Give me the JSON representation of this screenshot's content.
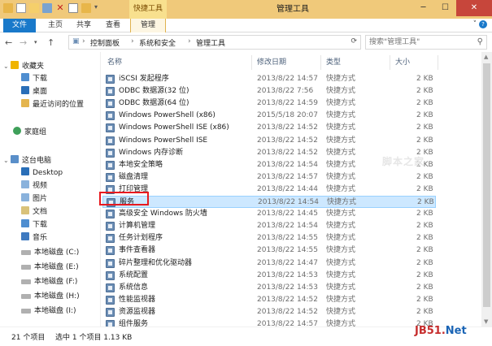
{
  "window": {
    "title": "管理工具",
    "tool_tab": "快捷工具"
  },
  "ribbon": {
    "tabs": [
      "文件",
      "主页",
      "共享",
      "查看",
      "管理"
    ]
  },
  "address": {
    "crumbs": [
      "控制面板",
      "系统和安全",
      "管理工具"
    ],
    "search_placeholder": "搜索\"管理工具\""
  },
  "nav": {
    "favorites": "收藏夹",
    "fav_items": [
      "下载",
      "桌面",
      "最近访问的位置"
    ],
    "homegroup": "家庭组",
    "thispc": "这台电脑",
    "pc_items": [
      "Desktop",
      "视频",
      "图片",
      "文档",
      "下载",
      "音乐",
      "本地磁盘 (C:)",
      "本地磁盘 (E:)",
      "本地磁盘 (F:)",
      "本地磁盘 (H:)",
      "本地磁盘 (I:)"
    ]
  },
  "columns": {
    "name": "名称",
    "date": "修改日期",
    "type": "类型",
    "size": "大小"
  },
  "files": [
    {
      "name": "iSCSI 发起程序",
      "date": "2013/8/22 14:57",
      "type": "快捷方式",
      "size": "2 KB"
    },
    {
      "name": "ODBC 数据源(32 位)",
      "date": "2013/8/22 7:56",
      "type": "快捷方式",
      "size": "2 KB"
    },
    {
      "name": "ODBC 数据源(64 位)",
      "date": "2013/8/22 14:59",
      "type": "快捷方式",
      "size": "2 KB"
    },
    {
      "name": "Windows PowerShell (x86)",
      "date": "2015/5/18 20:07",
      "type": "快捷方式",
      "size": "2 KB"
    },
    {
      "name": "Windows PowerShell ISE (x86)",
      "date": "2013/8/22 14:52",
      "type": "快捷方式",
      "size": "2 KB"
    },
    {
      "name": "Windows PowerShell ISE",
      "date": "2013/8/22 14:52",
      "type": "快捷方式",
      "size": "2 KB"
    },
    {
      "name": "Windows 内存诊断",
      "date": "2013/8/22 14:52",
      "type": "快捷方式",
      "size": "2 KB"
    },
    {
      "name": "本地安全策略",
      "date": "2013/8/22 14:54",
      "type": "快捷方式",
      "size": "2 KB"
    },
    {
      "name": "磁盘清理",
      "date": "2013/8/22 14:57",
      "type": "快捷方式",
      "size": "2 KB"
    },
    {
      "name": "打印管理",
      "date": "2013/8/22 14:44",
      "type": "快捷方式",
      "size": "2 KB"
    },
    {
      "name": "服务",
      "date": "2013/8/22 14:54",
      "type": "快捷方式",
      "size": "2 KB"
    },
    {
      "name": "高级安全 Windows 防火墙",
      "date": "2013/8/22 14:45",
      "type": "快捷方式",
      "size": "2 KB"
    },
    {
      "name": "计算机管理",
      "date": "2013/8/22 14:54",
      "type": "快捷方式",
      "size": "2 KB"
    },
    {
      "name": "任务计划程序",
      "date": "2013/8/22 14:55",
      "type": "快捷方式",
      "size": "2 KB"
    },
    {
      "name": "事件查看器",
      "date": "2013/8/22 14:55",
      "type": "快捷方式",
      "size": "2 KB"
    },
    {
      "name": "碎片整理和优化驱动器",
      "date": "2013/8/22 14:47",
      "type": "快捷方式",
      "size": "2 KB"
    },
    {
      "name": "系统配置",
      "date": "2013/8/22 14:53",
      "type": "快捷方式",
      "size": "2 KB"
    },
    {
      "name": "系统信息",
      "date": "2013/8/22 14:53",
      "type": "快捷方式",
      "size": "2 KB"
    },
    {
      "name": "性能监视器",
      "date": "2013/8/22 14:52",
      "type": "快捷方式",
      "size": "2 KB"
    },
    {
      "name": "资源监视器",
      "date": "2013/8/22 14:52",
      "type": "快捷方式",
      "size": "2 KB"
    },
    {
      "name": "组件服务",
      "date": "2013/8/22 14:57",
      "type": "快捷方式",
      "size": "2 KB"
    }
  ],
  "selected_index": 10,
  "status": {
    "count": "21 个项目",
    "selection": "选中 1 个项目  1.13 KB"
  },
  "watermarks": {
    "corner_red": "JB51.",
    "corner_blue": "Net",
    "faint": "脚本之家"
  },
  "colors": {
    "file_tab": "#1979ca",
    "tool_tab_bg": "#f0c97a",
    "selection": "#cde8ff",
    "highlight_box": "#e8191e"
  }
}
